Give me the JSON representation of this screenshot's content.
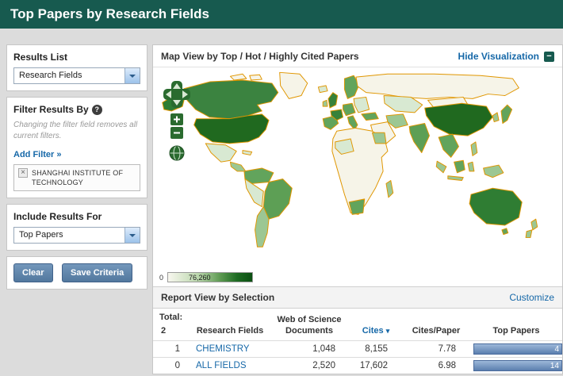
{
  "header": {
    "title": "Top Papers by Research Fields"
  },
  "icons": {
    "minus": "−",
    "sort_desc": "▾"
  },
  "sidebar": {
    "results_list_label": "Results List",
    "results_list_value": "Research Fields",
    "filter_label": "Filter Results By",
    "filter_help": "?",
    "filter_note": "Changing the filter field removes all current filters.",
    "add_filter_link": "Add Filter »",
    "filter_tag": {
      "remove": "×",
      "label": "SHANGHAI INSTITUTE OF TECHNOLOGY"
    },
    "include_label": "Include Results For",
    "include_value": "Top Papers",
    "clear_button": "Clear",
    "save_button": "Save Criteria"
  },
  "map": {
    "title": "Map View by Top / Hot / Highly Cited Papers",
    "hide_link": "Hide Visualization",
    "legend_min": "0",
    "legend_max": "76,260",
    "colors": {
      "low": "#f6f4e8",
      "high": "#0b4f12",
      "border": "#e09600"
    }
  },
  "report": {
    "title": "Report View by Selection",
    "customize_link": "Customize",
    "total_label": "Total:",
    "total_value": "2",
    "col_research_fields": "Research Fields",
    "col_docs_line1": "Web of Science",
    "col_docs_line2": "Documents",
    "col_cites": "Cites",
    "col_cites_paper": "Cites/Paper",
    "col_top_papers": "Top Papers",
    "rows": [
      {
        "num": "1",
        "field": "CHEMISTRY",
        "docs": "1,048",
        "cites": "8,155",
        "cites_per_paper": "7.78",
        "top_papers": "4"
      },
      {
        "num": "0",
        "field": "ALL FIELDS",
        "docs": "2,520",
        "cites": "17,602",
        "cites_per_paper": "6.98",
        "top_papers": "14"
      }
    ]
  }
}
